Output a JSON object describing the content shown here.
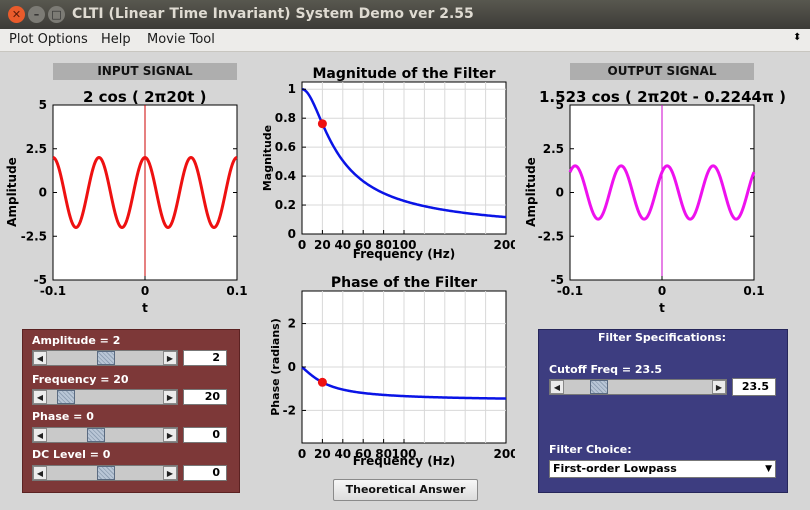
{
  "window": {
    "title": "CLTI (Linear Time Invariant) System Demo ver 2.55"
  },
  "menu": {
    "plot_options": "Plot Options",
    "help": "Help",
    "movie_tool": "Movie Tool"
  },
  "input": {
    "header": "INPUT SIGNAL",
    "formula": "2 cos ( 2π20t )",
    "ylabel": "Amplitude",
    "xlabel": "t",
    "yticks": [
      "5",
      "2.5",
      "0",
      "-2.5",
      "-5"
    ],
    "xticks": [
      "-0.1",
      "0",
      "0.1"
    ]
  },
  "output": {
    "header": "OUTPUT SIGNAL",
    "formula": "1.523 cos ( 2π20t - 0.2244π )",
    "ylabel": "Amplitude",
    "xlabel": "t",
    "yticks": [
      "5",
      "2.5",
      "0",
      "-2.5",
      "-5"
    ],
    "xticks": [
      "-0.1",
      "0",
      "0.1"
    ]
  },
  "magnitude": {
    "title": "Magnitude of the Filter",
    "ylabel": "Magnitude",
    "xlabel": "Frequency (Hz)",
    "yticks": [
      "1",
      "0.8",
      "0.6",
      "0.4",
      "0.2",
      "0"
    ],
    "xticks": [
      "0",
      "20",
      "40",
      "60",
      "80",
      "100",
      "200"
    ]
  },
  "phase": {
    "title": "Phase of the Filter",
    "ylabel": "Phase (radians)",
    "xlabel": "Frequency (Hz)",
    "yticks": [
      "2",
      "0",
      "-2"
    ],
    "xticks": [
      "0",
      "20",
      "40",
      "60",
      "80",
      "100",
      "200"
    ]
  },
  "controls": {
    "amplitude_label": "Amplitude = 2",
    "amplitude_value": "2",
    "amplitude_level": 0.5,
    "frequency_label": "Frequency = 20",
    "frequency_value": "20",
    "frequency_level": 0.1,
    "phase_label": "Phase = 0",
    "phase_value": "0",
    "phase_level": 0.4,
    "dc_label": "DC Level = 0",
    "dc_value": "0",
    "dc_level": 0.5
  },
  "filter": {
    "title": "Filter Specifications:",
    "cutoff_label": "Cutoff Freq = 23.5",
    "cutoff_value": "23.5",
    "cutoff_level": 0.2,
    "choice_label": "Filter Choice:",
    "choice_value": "First-order Lowpass"
  },
  "theoretical_button": "Theoretical Answer",
  "colors": {
    "input": "#ee1111",
    "output": "#ee11ee",
    "response": "#0a14e6",
    "marker": "#ee1111",
    "red_panel": "#7d3838",
    "blue_panel": "#3d3d80"
  },
  "chart_data": [
    {
      "type": "line",
      "name": "input",
      "x_range": [
        -0.1,
        0.1
      ],
      "ylim": [
        -5,
        5
      ],
      "amplitude": 2,
      "frequency_hz": 20,
      "phase_pi": 0,
      "dc": 0
    },
    {
      "type": "line",
      "name": "output",
      "x_range": [
        -0.1,
        0.1
      ],
      "ylim": [
        -5,
        5
      ],
      "amplitude": 1.523,
      "frequency_hz": 20,
      "phase_pi": -0.2244,
      "dc": 0
    },
    {
      "type": "line",
      "name": "magnitude",
      "xlim": [
        0,
        200
      ],
      "ylim": [
        0,
        1.05
      ],
      "cutoff_hz": 23.5,
      "marker": {
        "x": 20,
        "y": 0.762
      }
    },
    {
      "type": "line",
      "name": "phase",
      "xlim": [
        0,
        200
      ],
      "ylim": [
        -3.5,
        3.5
      ],
      "cutoff_hz": 23.5,
      "marker": {
        "x": 20,
        "y": -0.705
      }
    }
  ]
}
